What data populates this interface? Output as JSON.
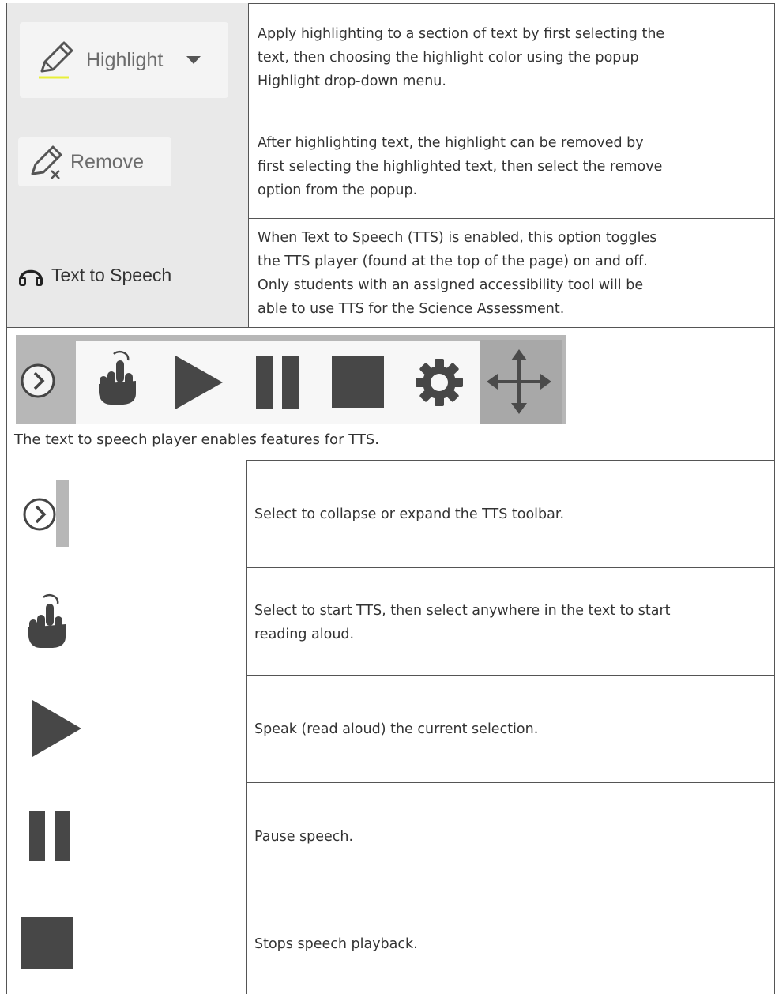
{
  "features": [
    {
      "label": "Highlight",
      "icon": "pencil-highlight-icon",
      "description_lines": [
        "Apply highlighting to a section of text by first selecting the",
        "text, then choosing the highlight color using the popup",
        "Highlight drop-down menu."
      ]
    },
    {
      "label": "Remove",
      "icon": "pencil-remove-icon",
      "description_lines": [
        "After highlighting text, the highlight can be removed by",
        "first selecting the highlighted text, then select the remove",
        "option from the popup."
      ]
    },
    {
      "label": "Text to Speech",
      "icon": "headphones-icon",
      "description_lines": [
        "When Text to Speech (TTS) is enabled, this option toggles",
        "the TTS player (found at the top of the page) on and off.",
        "Only students with an assigned accessibility tool will be",
        "able to use TTS for the Science Assessment."
      ]
    }
  ],
  "player_caption": "The text to speech player enables features for TTS.",
  "player_icons": [
    "collapse-icon",
    "pointer-hand-icon",
    "play-icon",
    "pause-icon",
    "stop-icon",
    "settings-gear-icon",
    "move-arrows-icon"
  ],
  "controls": [
    {
      "icon": "collapse-icon",
      "description_lines": [
        "Select to collapse or expand the TTS toolbar."
      ]
    },
    {
      "icon": "pointer-hand-icon",
      "description_lines": [
        "Select to start TTS, then select anywhere in the text to start",
        "reading aloud."
      ]
    },
    {
      "icon": "play-icon",
      "description_lines": [
        "Speak (read aloud) the current selection."
      ]
    },
    {
      "icon": "pause-icon",
      "description_lines": [
        "Pause speech."
      ]
    },
    {
      "icon": "stop-icon",
      "description_lines": [
        "Stops speech playback."
      ]
    }
  ],
  "colors": {
    "highlight_underline": "#e8ef3a",
    "icon_dark": "#474747",
    "toolbar_gray": "#b7b7b7",
    "move_gray": "#a8a8a8"
  }
}
